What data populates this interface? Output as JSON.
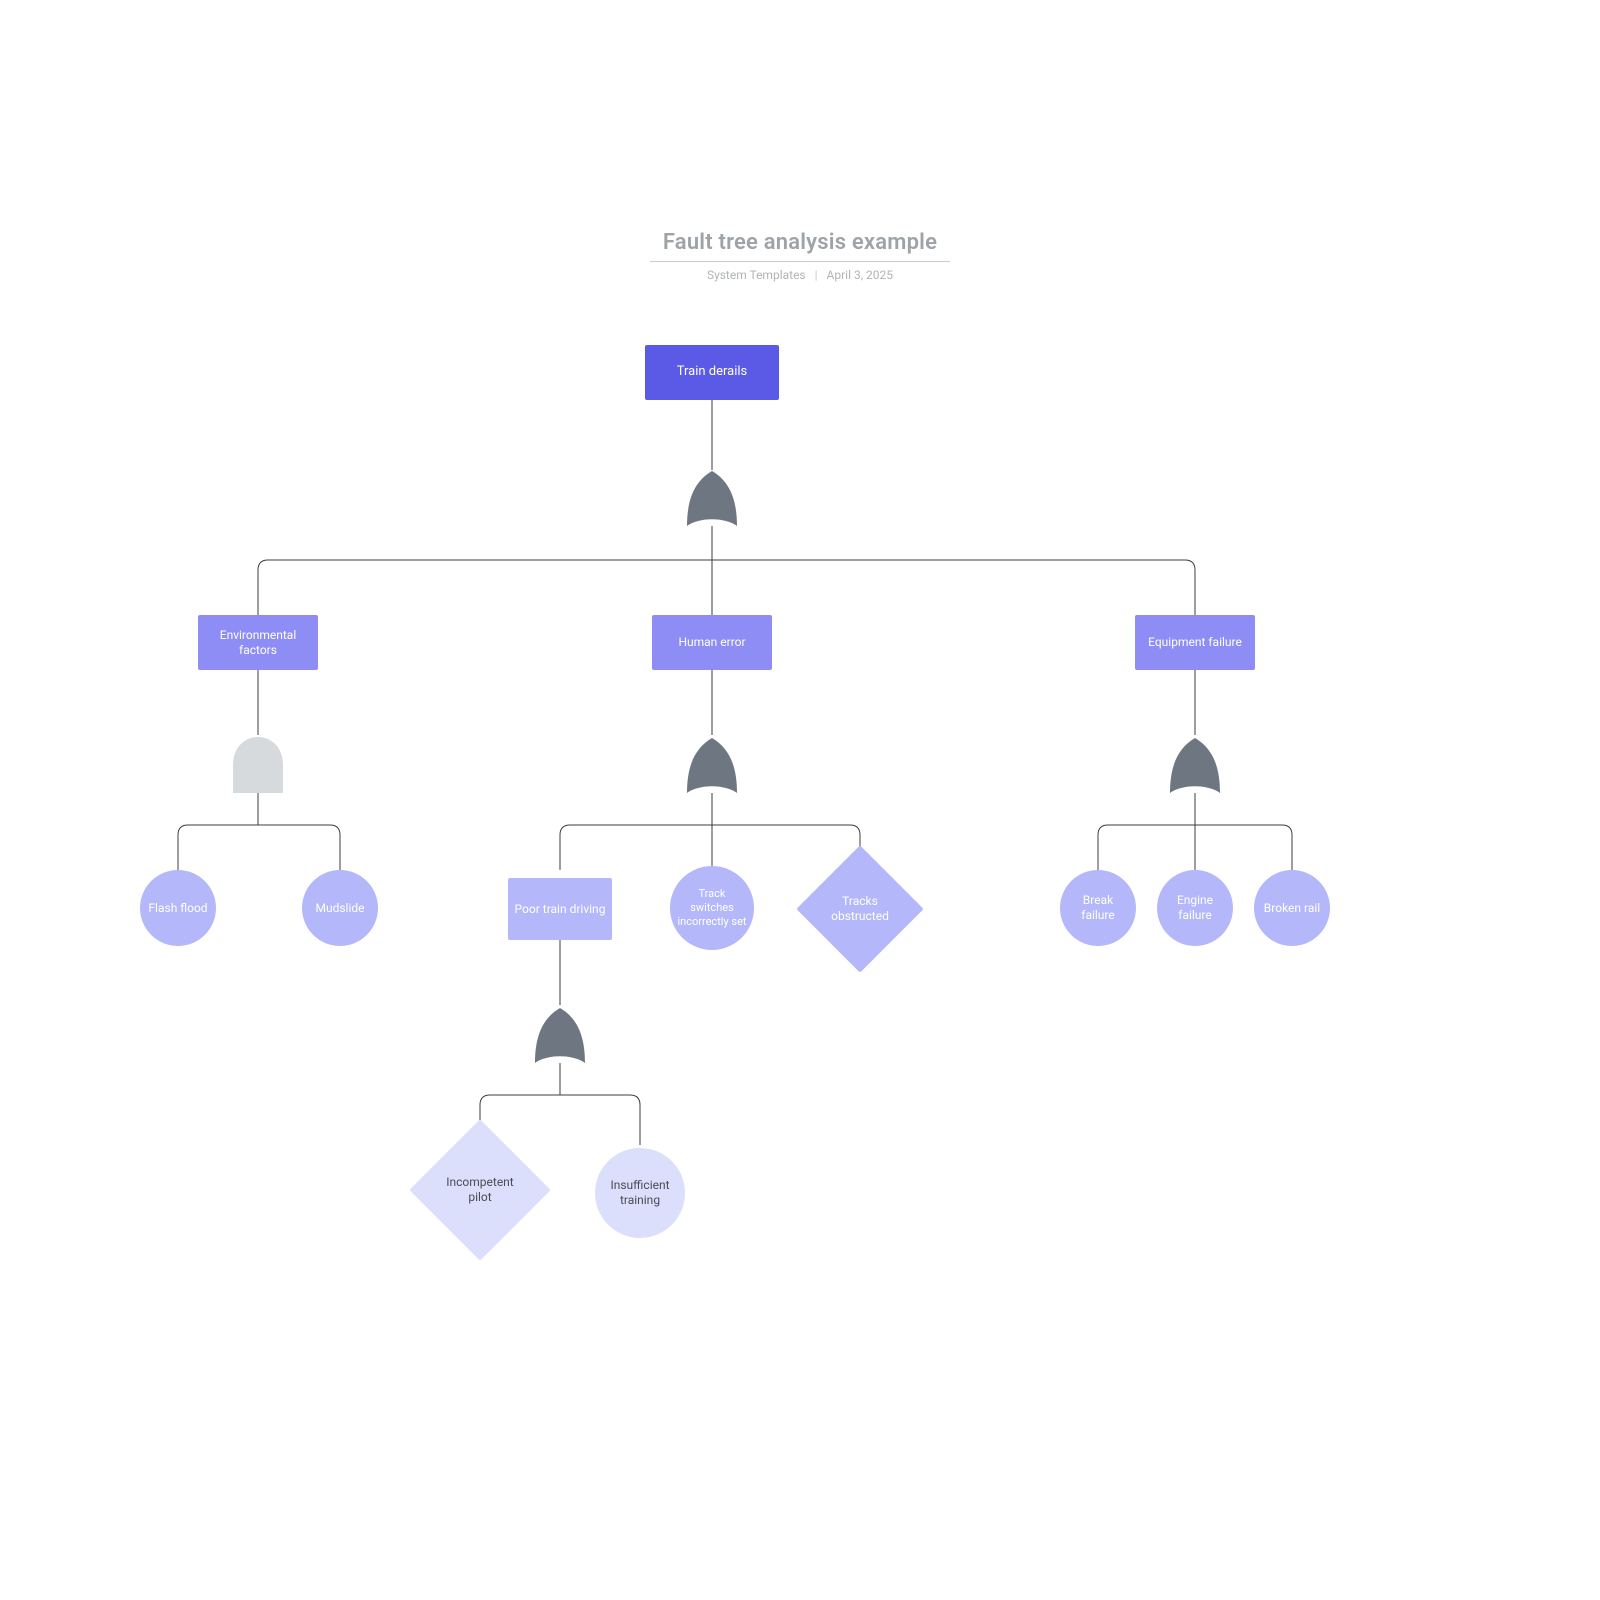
{
  "title": {
    "heading": "Fault tree analysis example",
    "author": "System Templates",
    "date": "April 3, 2025"
  },
  "colors": {
    "top": "#5a5ae6",
    "mid": "#8d8df5",
    "leaf": "#b4b7f9",
    "light": "#dcdffc",
    "gate_dark": "#6e7781",
    "gate_light": "#d6dadd",
    "stroke": "#3d3d3d",
    "text_dark": "#4a4c55"
  },
  "nodes": {
    "top_event": "Train derails",
    "environmental": "Environmental factors",
    "human_error": "Human error",
    "equipment_failure": "Equipment failure",
    "flash_flood": "Flash flood",
    "mudslide": "Mudslide",
    "poor_train_driving": "Poor train driving",
    "track_switches": "Track switches incorrectly set",
    "tracks_obstructed": "Tracks obstructed",
    "break_failure": "Break failure",
    "engine_failure": "Engine failure",
    "broken_rail": "Broken rail",
    "incompetent_pilot": "Incompetent pilot",
    "insufficient_training": "Insufficient training"
  },
  "gates": {
    "top": "OR",
    "environment": "AND",
    "human": "OR",
    "equipment": "OR",
    "driving": "OR"
  },
  "chart_data": {
    "type": "fault_tree",
    "top_event": "Train derails",
    "children": [
      {
        "gate": "OR",
        "inputs": [
          {
            "event": "Environmental factors",
            "gate": "AND",
            "inputs": [
              {
                "event": "Flash flood",
                "type": "basic"
              },
              {
                "event": "Mudslide",
                "type": "basic"
              }
            ]
          },
          {
            "event": "Human error",
            "gate": "OR",
            "inputs": [
              {
                "event": "Poor train driving",
                "gate": "OR",
                "inputs": [
                  {
                    "event": "Incompetent pilot",
                    "type": "undeveloped"
                  },
                  {
                    "event": "Insufficient training",
                    "type": "basic"
                  }
                ]
              },
              {
                "event": "Track switches incorrectly set",
                "type": "basic"
              },
              {
                "event": "Tracks obstructed",
                "type": "undeveloped"
              }
            ]
          },
          {
            "event": "Equipment failure",
            "gate": "OR",
            "inputs": [
              {
                "event": "Break failure",
                "type": "basic"
              },
              {
                "event": "Engine failure",
                "type": "basic"
              },
              {
                "event": "Broken rail",
                "type": "basic"
              }
            ]
          }
        ]
      }
    ]
  }
}
